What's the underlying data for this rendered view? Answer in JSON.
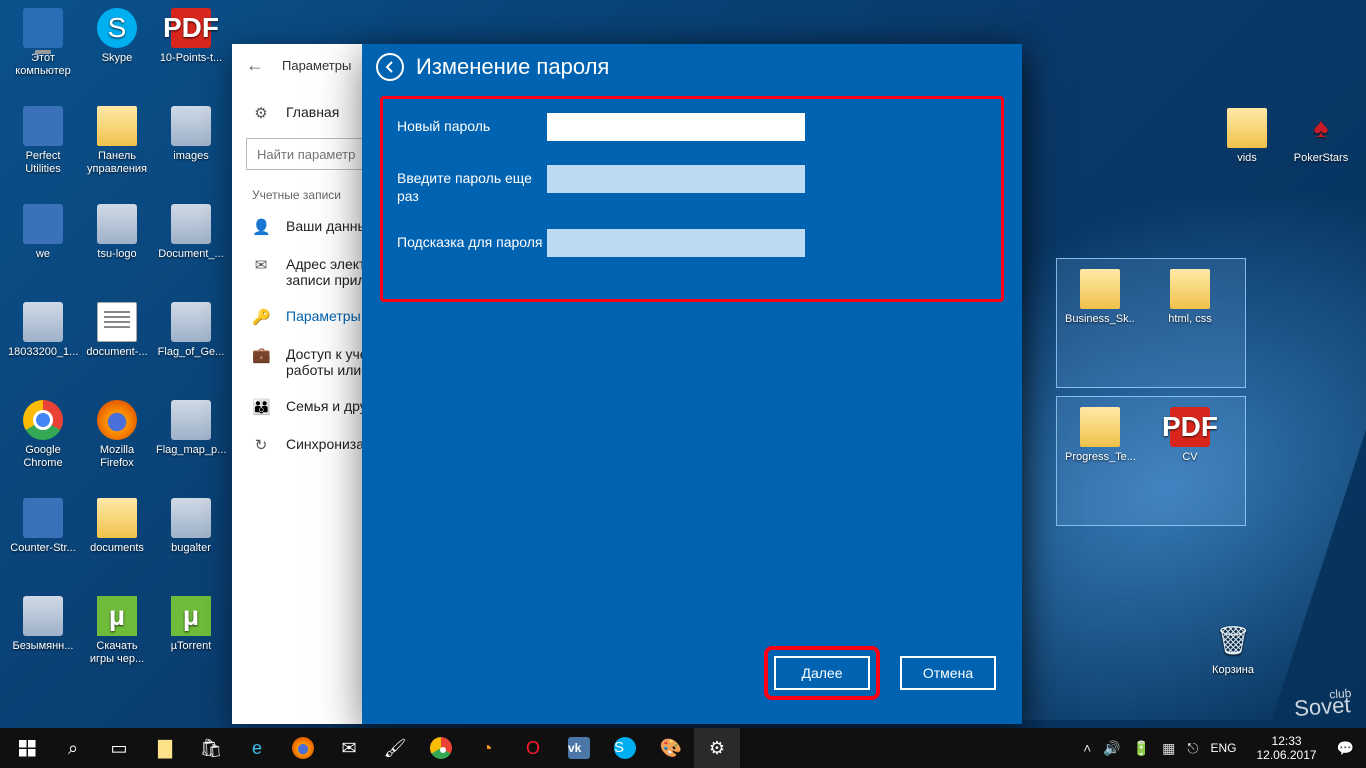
{
  "desktop_icons_left": [
    {
      "label": "Этот\nкомпьютер",
      "icon": "pc"
    },
    {
      "label": "Skype",
      "icon": "skype"
    },
    {
      "label": "10-Points-t...",
      "icon": "pdf"
    },
    {
      "label": "Perfect\nUtilities",
      "icon": "gen"
    },
    {
      "label": "Панель\nуправления",
      "icon": "folder"
    },
    {
      "label": "images",
      "icon": "img"
    },
    {
      "label": "we",
      "icon": "gen"
    },
    {
      "label": "tsu-logo",
      "icon": "img"
    },
    {
      "label": "Document_...",
      "icon": "img"
    },
    {
      "label": "18033200_1...",
      "icon": "img"
    },
    {
      "label": "document-...",
      "icon": "txt"
    },
    {
      "label": "Flag_of_Ge...",
      "icon": "img"
    },
    {
      "label": "Google\nChrome",
      "icon": "chrome"
    },
    {
      "label": "Mozilla\nFirefox",
      "icon": "ff"
    },
    {
      "label": "Flag_map_p...",
      "icon": "img"
    },
    {
      "label": "Counter-Str...",
      "icon": "gen"
    },
    {
      "label": "documents",
      "icon": "folder"
    },
    {
      "label": "bugalter",
      "icon": "img"
    },
    {
      "label": "Безымянн...",
      "icon": "img"
    },
    {
      "label": "Скачать\nигры чер...",
      "icon": "tor"
    },
    {
      "label": "µTorrent",
      "icon": "tor"
    }
  ],
  "desktop_icons_right": [
    {
      "label": "vids",
      "icon": "folder"
    },
    {
      "label": "PokerStars",
      "icon": "star"
    }
  ],
  "selection_folders": [
    {
      "label": "Business_Sk...",
      "icon": "folder"
    },
    {
      "label": "html, css",
      "icon": "folder"
    },
    {
      "label": "Progress_Te...",
      "icon": "folder"
    },
    {
      "label": "CV",
      "icon": "pdf"
    }
  ],
  "recycle": {
    "label": "Корзина"
  },
  "settings": {
    "back_tooltip": "Назад",
    "title": "Параметры",
    "home": "Главная",
    "search_placeholder": "Найти параметр",
    "section": "Учетные записи",
    "items": [
      {
        "icon": "person",
        "label": "Ваши данные"
      },
      {
        "icon": "mail",
        "label": "Адрес электронной почты; учетные записи приложений"
      },
      {
        "icon": "key",
        "label": "Параметры входа"
      },
      {
        "icon": "work",
        "label": "Доступ к учетной записи места работы или учебного заведения"
      },
      {
        "icon": "family",
        "label": "Семья и другие люди"
      },
      {
        "icon": "sync",
        "label": "Синхронизация ваших параметров"
      }
    ],
    "active_index": 2
  },
  "dialog": {
    "title": "Изменение пароля",
    "fields": [
      {
        "label": "Новый пароль",
        "type": "password",
        "primary": true
      },
      {
        "label": "Введите пароль еще раз",
        "type": "password",
        "primary": false
      },
      {
        "label": "Подсказка для пароля",
        "type": "text",
        "primary": false
      }
    ],
    "next": "Далее",
    "cancel": "Отмена"
  },
  "taskbar": {
    "lang": "ENG",
    "time": "12:33",
    "date": "12.06.2017"
  },
  "watermark": {
    "top": "club",
    "bottom": "Sovet"
  }
}
